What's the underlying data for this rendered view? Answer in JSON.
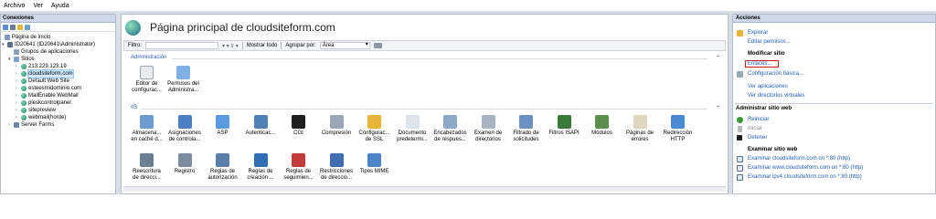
{
  "menubar": {
    "items": [
      "Archivo",
      "Ver",
      "Ayuda"
    ]
  },
  "connections": {
    "header": "Conexiones",
    "tree": [
      {
        "label": "Página de inicio",
        "icon": "home-icon"
      },
      {
        "label": "ID20641 (ID20641\\Administrator)",
        "icon": "server-icon"
      },
      {
        "label": "Grupos de aplicaciones",
        "icon": "app-pool-icon"
      },
      {
        "label": "Sitios",
        "icon": "folder-icon"
      },
      {
        "label": "213.229.123.19",
        "icon": "globe-icon"
      },
      {
        "label": "cloudsiteform.com",
        "icon": "globe-icon"
      },
      {
        "label": "Default Web Site",
        "icon": "globe-icon"
      },
      {
        "label": "esteesmidominio.com",
        "icon": "globe-icon"
      },
      {
        "label": "MailEnable WebMail",
        "icon": "globe-icon"
      },
      {
        "label": "pleskcontrolpanel",
        "icon": "globe-icon"
      },
      {
        "label": "sitepreview",
        "icon": "globe-icon"
      },
      {
        "label": "webmail(horde)",
        "icon": "globe-icon"
      },
      {
        "label": "Server Farms",
        "icon": "server-farm-icon"
      }
    ]
  },
  "center": {
    "title": "Página principal de cloudsiteform.com",
    "filter_label": "Filtro:",
    "filter_go": "▾ ▾ Ir ▾",
    "show_all": "Mostrar todo",
    "group_by_label": "Agrupar por:",
    "group_by_value": "Área",
    "sections": {
      "admin": "Administración",
      "iis": "IIS"
    },
    "admin_features": [
      {
        "label1": "Editor de",
        "label2": "configurac...",
        "icon": "config-editor-icon",
        "color": "#e9e9ee"
      },
      {
        "label1": "Permisos del",
        "label2": "Administra...",
        "icon": "permissions-icon",
        "color": "#7fb0e6"
      }
    ],
    "iis_row1": [
      {
        "label1": "Almacena...",
        "label2": "en caché d...",
        "icon": "cache-icon",
        "color": "#6d9bd0"
      },
      {
        "label1": "Asignaciones",
        "label2": "de controla...",
        "icon": "handler-icon",
        "color": "#4d80c3"
      },
      {
        "label1": "ASP",
        "label2": "",
        "icon": "asp-icon",
        "color": "#5a9be0"
      },
      {
        "label1": "Autenticac...",
        "label2": "",
        "icon": "auth-icon",
        "color": "#5082b8"
      },
      {
        "label1": "CGI",
        "label2": "",
        "icon": "cgi-icon",
        "color": "#1f1f1f"
      },
      {
        "label1": "Compresión",
        "label2": "",
        "icon": "compression-icon",
        "color": "#9aa7b6"
      },
      {
        "label1": "Configurac...",
        "label2": "de SSL",
        "icon": "ssl-icon",
        "color": "#e6b53a"
      },
      {
        "label1": "Documento",
        "label2": "predetermi...",
        "icon": "default-doc-icon",
        "color": "#dde4ec"
      },
      {
        "label1": "Encabezados",
        "label2": "de respues...",
        "icon": "headers-icon",
        "color": "#8ea8c8"
      },
      {
        "label1": "Examen de",
        "label2": "directorios",
        "icon": "dir-browse-icon",
        "color": "#a8b4c2"
      },
      {
        "label1": "Filtrado de",
        "label2": "solicitudes",
        "icon": "request-filter-icon",
        "color": "#6a8fc0"
      },
      {
        "label1": "Filtros ISAPI",
        "label2": "",
        "icon": "isapi-icon",
        "color": "#3a7a3a"
      },
      {
        "label1": "Módulos",
        "label2": "",
        "icon": "modules-icon",
        "color": "#5c8f4d"
      },
      {
        "label1": "Páginas de",
        "label2": "errores",
        "icon": "error-pages-icon",
        "color": "#e0d6c0"
      },
      {
        "label1": "Redirección",
        "label2": "HTTP",
        "icon": "redirect-icon",
        "color": "#4a8ad4"
      }
    ],
    "iis_row2": [
      {
        "label1": "Reescritura",
        "label2": "de direcci...",
        "icon": "rewrite-icon",
        "color": "#6d7f94"
      },
      {
        "label1": "Registro",
        "label2": "",
        "icon": "logging-icon",
        "color": "#7b8ca0"
      },
      {
        "label1": "Reglas de",
        "label2": "autorización",
        "icon": "authz-icon",
        "color": "#5b7fa8"
      },
      {
        "label1": "Reglas de",
        "label2": "creación ...",
        "icon": "build-rules-icon",
        "color": "#2e6fb3"
      },
      {
        "label1": "Reglas de",
        "label2": "seguimien...",
        "icon": "tracing-icon",
        "color": "#c23b3b"
      },
      {
        "label1": "Restricciones",
        "label2": "de direccio...",
        "icon": "ip-restrict-icon",
        "color": "#3f6eb0"
      },
      {
        "label1": "Tipos MIME",
        "label2": "",
        "icon": "mime-icon",
        "color": "#4d84c7"
      }
    ]
  },
  "actions": {
    "header": "Acciones",
    "explore": "Explorar",
    "edit_permissions": "Editar permisos...",
    "modify_site_header": "Modificar sitio",
    "bindings": "Enlaces...",
    "basic_config": "Configuración básica...",
    "view_apps": "Ver aplicaciones",
    "view_vdirs": "Ver directorios virtuales",
    "manage_site_header": "Administrar sitio web",
    "restart": "Reiniciar",
    "start": "Iniciar",
    "stop": "Detener",
    "browse_header": "Examinar sitio web",
    "browse1": "Examinar cloudsiteform.com on *:80 (http)",
    "browse2": "Examinar www.cloudsiteform.com on *:80 (http)",
    "browse3": "Examinar ipv4.cloudsiteform.com on *:80 (http)",
    "colors": {
      "link": "#1f5fb8",
      "highlight": "#d01a1a"
    }
  }
}
